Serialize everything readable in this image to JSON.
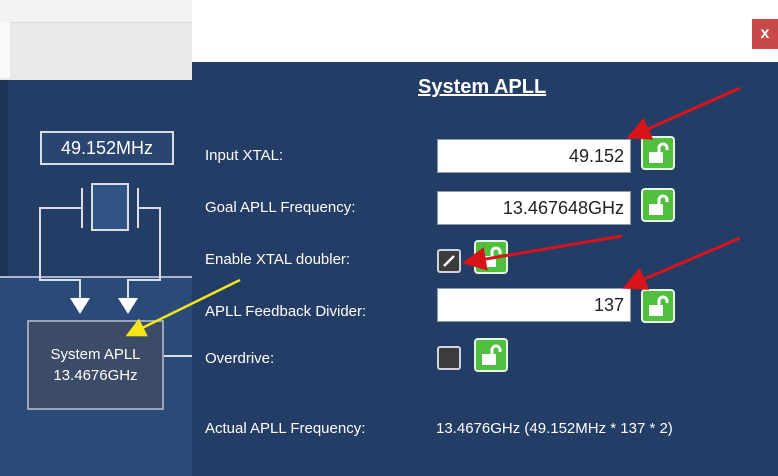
{
  "dialog": {
    "title": "System APLL",
    "close_label": "x"
  },
  "diagram": {
    "xtal_label": "49.152MHz",
    "apll_line1": "System APLL",
    "apll_line2": "13.4676GHz"
  },
  "form": {
    "input_xtal": {
      "label": "Input XTAL:",
      "value": "49.152"
    },
    "goal_freq": {
      "label": "Goal APLL Frequency:",
      "value": "13.467648GHz"
    },
    "xtal_doubler": {
      "label": "Enable XTAL doubler:",
      "checked": true
    },
    "feedback_divider": {
      "label": "APLL Feedback Divider:",
      "value": "137"
    },
    "overdrive": {
      "label": "Overdrive:",
      "checked": false
    },
    "actual_freq": {
      "label": "Actual APLL Frequency:",
      "value": "13.4676GHz (49.152MHz * 137 * 2)"
    }
  },
  "colors": {
    "panel_bg": "#233d66",
    "lock_green": "#4fbf3d",
    "close_red": "#c8494a",
    "annotation_red": "#d7141a",
    "annotation_yellow": "#f2e51a"
  },
  "icons": [
    "unlock-icon",
    "checkmark-icon",
    "close-icon"
  ]
}
